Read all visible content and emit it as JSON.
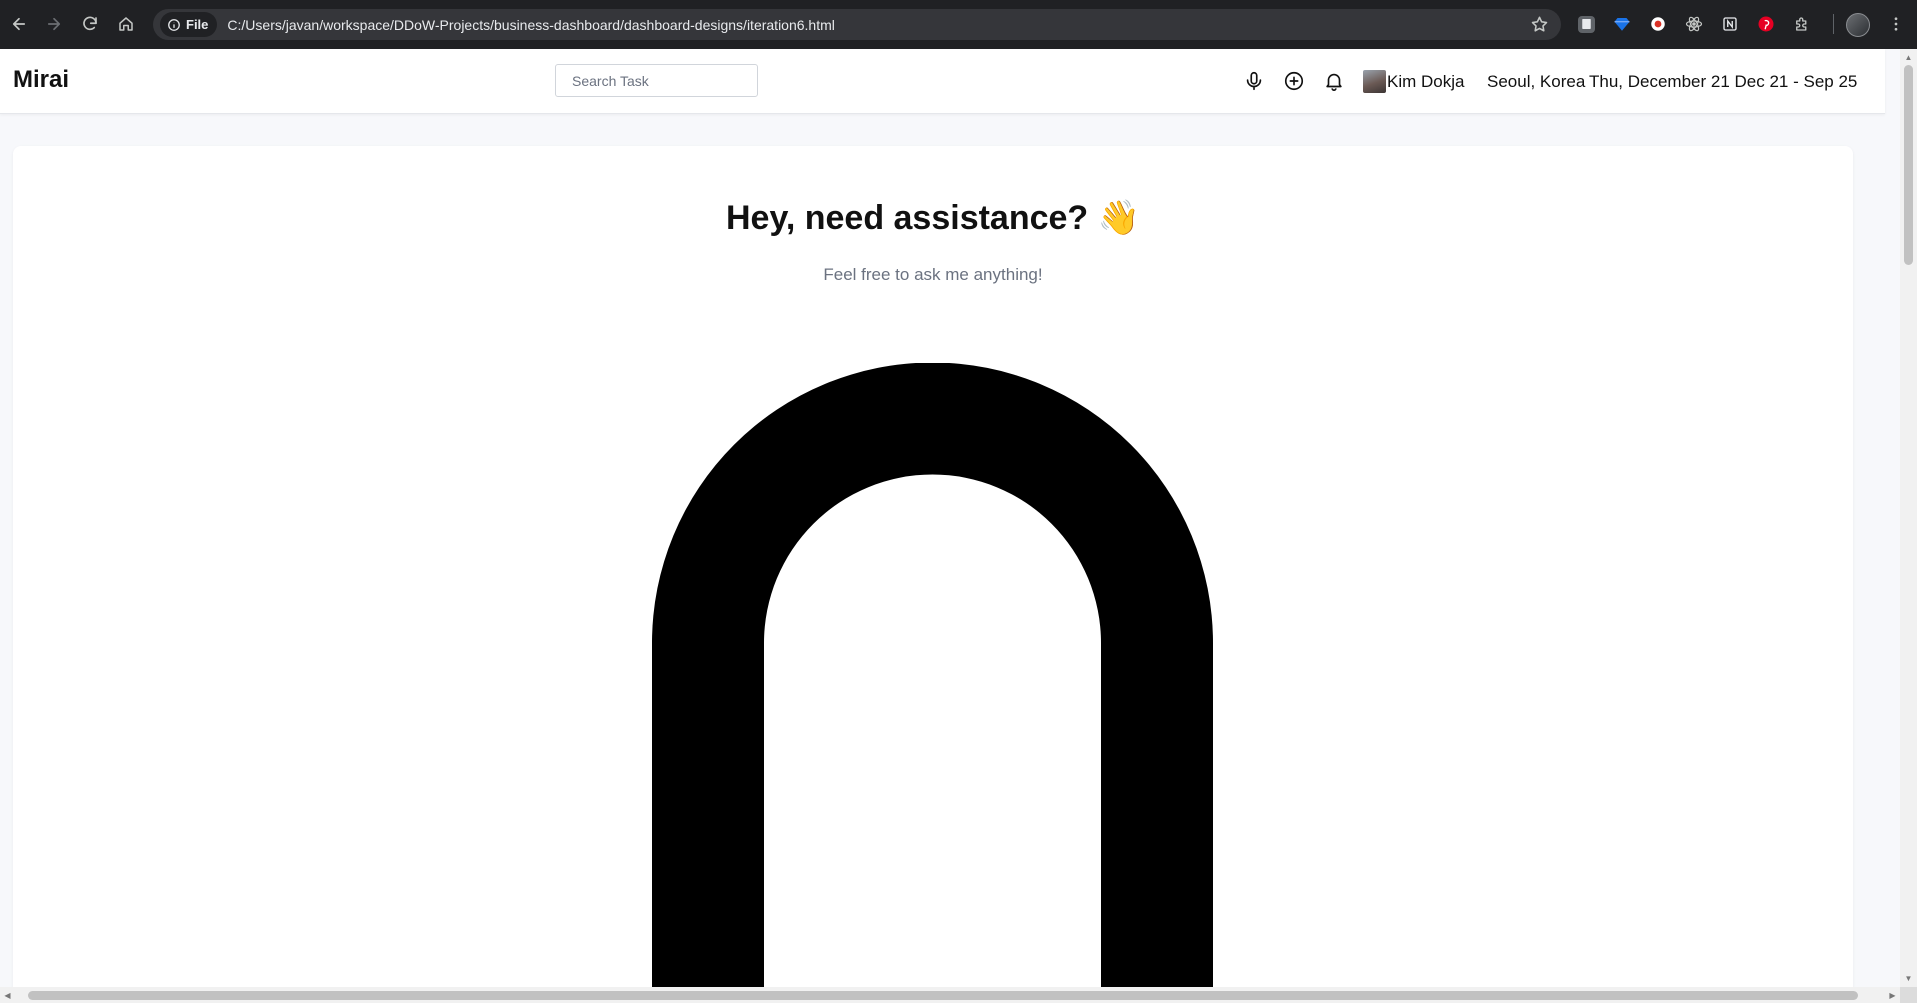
{
  "browser": {
    "site_chip": "File",
    "url": "C:/Users/javan/workspace/DDoW-Projects/business-dashboard/dashboard-designs/iteration6.html"
  },
  "topbar": {
    "brand": "Mirai",
    "search": {
      "placeholder": "Search Task",
      "value": ""
    },
    "user_name": "Kim Dokja",
    "user_location": "Seoul, Korea",
    "date_range": "Thu, December 21 Dec 21 - Sep 25"
  },
  "hero": {
    "title": "Hey, need assistance?",
    "emoji": "👋",
    "subtitle": "Feel free to ask me anything!"
  },
  "icons": {
    "mic": "microphone-icon",
    "add": "plus-circle-icon",
    "bell": "bell-icon"
  },
  "colors": {
    "chrome_bg": "#202124",
    "page_bg": "#f7f8fb",
    "card_bg": "#ffffff",
    "text_primary": "#111111",
    "text_muted": "#6b7280"
  }
}
